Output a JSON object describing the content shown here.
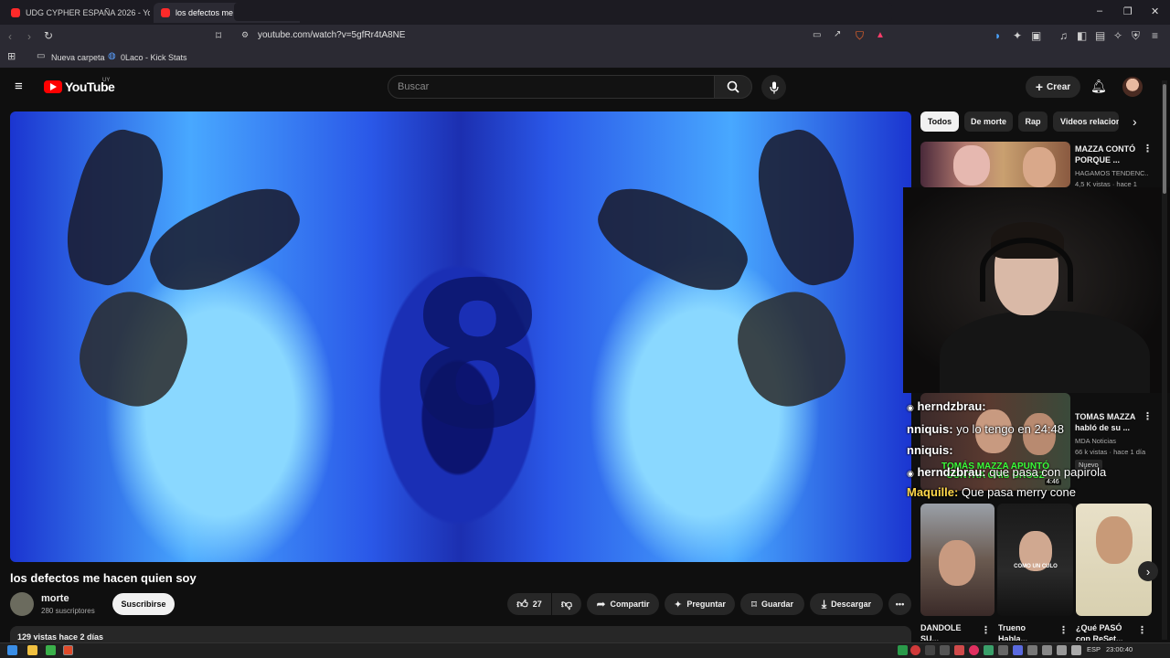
{
  "browser": {
    "tabs": [
      {
        "title": "UDG CYPHER ESPAÑA 2026 - YouTube",
        "active": false
      },
      {
        "title": "los defectos me hacen quien soy",
        "active": true
      }
    ],
    "url": "youtube.com/watch?v=5gfRr4tA8NE",
    "bookmarks": [
      "Nueva carpeta",
      "0Laco - Kick Stats"
    ]
  },
  "youtube": {
    "logo_text": "YouTube",
    "country": "UY",
    "search_placeholder": "Buscar",
    "create_label": "Crear"
  },
  "video": {
    "title": "los defectos me hacen quien soy",
    "channel": "morte",
    "subscribers": "280 suscriptores",
    "subscribe_label": "Suscribirse",
    "likes": "27",
    "share_label": "Compartir",
    "ask_label": "Preguntar",
    "save_label": "Guardar",
    "download_label": "Descargar",
    "views_date": "129 vistas  hace 2 días",
    "overlay_digit": "8"
  },
  "chips": [
    "Todos",
    "De morte",
    "Rap",
    "Videos relacion"
  ],
  "sidebar": {
    "cards": [
      {
        "title": "MAZZA CONTÓ PORQUE ...",
        "channel": "HAGAMOS TENDENC...",
        "meta": "4,5 K vistas · hace 1"
      },
      {
        "title": "TOMAS MAZZA habló de su ...",
        "channel": "MDA Noticias",
        "meta": "66 k vistas · hace 1 día",
        "badge": "Nuevo",
        "duration": "4:46",
        "thumb_text": "TOMÁS MAZZA APUNTÓ CONTRA CRIS GROSZ"
      }
    ],
    "shorts": [
      {
        "title": "DANDOLE SU..."
      },
      {
        "title": "Trueno Habla..."
      },
      {
        "title": "¿Qué PASÓ con ReSet..."
      }
    ],
    "short_caption": "COMO UN CULO"
  },
  "chat": [
    {
      "user": "herndzbrau",
      "text": "",
      "user_color": "#ffffff"
    },
    {
      "user": "nniquis",
      "text": "yo lo tengo en 24:48",
      "user_color": "#ffffff"
    },
    {
      "user": "nniquis",
      "text": "",
      "user_color": "#ffffff"
    },
    {
      "user": "herndzbrau",
      "text": "que pasa con papirola",
      "user_color": "#ffffff"
    },
    {
      "user": "Maquille",
      "text": "Que pasa merry cone",
      "user_color": "#ffd84a"
    }
  ],
  "taskbar": {
    "lang": "ESP",
    "clock": "23:00:40"
  },
  "colors": {
    "accent": "#ff0000",
    "background": "#0f0f0f",
    "surface": "#272727"
  }
}
